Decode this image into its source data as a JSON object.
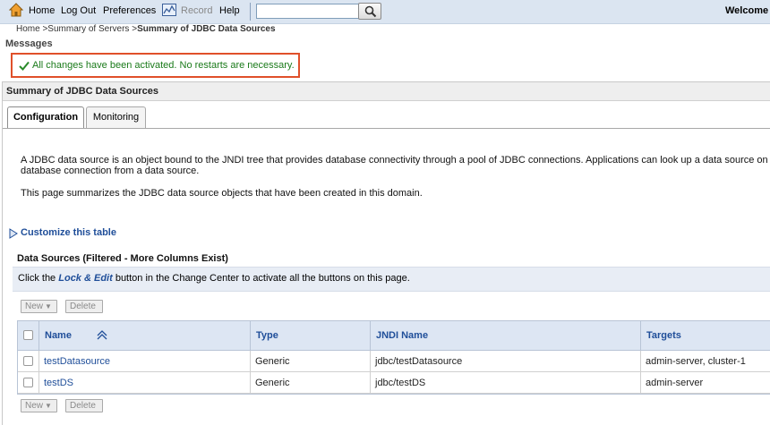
{
  "toolbar": {
    "home": "Home",
    "logout": "Log Out",
    "preferences": "Preferences",
    "record": "Record",
    "help": "Help",
    "search_value": "",
    "welcome": "Welcome"
  },
  "breadcrumb": {
    "home": "Home >",
    "servers": "Summary of Servers >",
    "current": "Summary of JDBC Data Sources"
  },
  "messages": {
    "label": "Messages",
    "text": "All changes have been activated. No restarts are necessary."
  },
  "page": {
    "title": "Summary of JDBC Data Sources",
    "tabs": [
      "Configuration",
      "Monitoring"
    ],
    "description_line1": "A JDBC data source is an object bound to the JNDI tree that provides database connectivity through a pool of JDBC connections. Applications can look up a data source on",
    "description_line2": "database connection from a data source.",
    "description_line3": "This page summarizes the JDBC data source objects that have been created in this domain.",
    "customize": "Customize this table"
  },
  "table": {
    "title": "Data Sources (Filtered - More Columns Exist)",
    "info_prefix": "Click the ",
    "info_emphasis": "Lock & Edit",
    "info_suffix": " button in the Change Center to activate all the buttons on this page.",
    "new_label": "New",
    "delete_label": "Delete",
    "columns": [
      "Name",
      "Type",
      "JNDI Name",
      "Targets"
    ],
    "rows": [
      {
        "name": "testDatasource",
        "type": "Generic",
        "jndi": "jdbc/testDatasource",
        "targets": "admin-server, cluster-1"
      },
      {
        "name": "testDS",
        "type": "Generic",
        "jndi": "jdbc/testDS",
        "targets": "admin-server"
      }
    ]
  }
}
